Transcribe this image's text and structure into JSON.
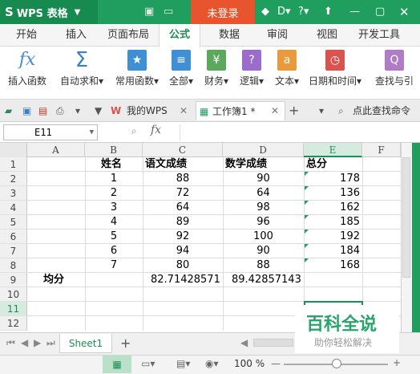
{
  "titlebar": {
    "app_name": "WPS 表格",
    "login_label": "未登录"
  },
  "ribbon_tabs": [
    "开始",
    "插入",
    "页面布局",
    "公式",
    "数据",
    "审阅",
    "视图",
    "开发工具"
  ],
  "ribbon_tab_active": "公式",
  "ribbon_buttons": {
    "insert_function": "插入函数",
    "autosum": "自动求和",
    "common_functions": "常用函数",
    "all": "全部",
    "finance": "财务",
    "logic": "逻辑",
    "text": "文本",
    "datetime": "日期和时间",
    "lookup": "查找与引"
  },
  "doc_tabs": {
    "my_wps": "我的WPS",
    "workbook": "工作簿1 *",
    "search": "点此查找命令"
  },
  "formula_bar": {
    "name_box": "E11",
    "fx": "fx"
  },
  "columns": [
    "A",
    "B",
    "C",
    "D",
    "E",
    "F"
  ],
  "rows": [
    "1",
    "2",
    "3",
    "4",
    "5",
    "6",
    "7",
    "8",
    "9",
    "10",
    "11",
    "12"
  ],
  "table": {
    "headers": {
      "name": "姓名",
      "chinese": "语文成绩",
      "math": "数学成绩",
      "total": "总分"
    },
    "data": [
      {
        "b": "1",
        "c": "88",
        "d": "90",
        "e": "178"
      },
      {
        "b": "2",
        "c": "72",
        "d": "64",
        "e": "136"
      },
      {
        "b": "3",
        "c": "64",
        "d": "98",
        "e": "162"
      },
      {
        "b": "4",
        "c": "89",
        "d": "96",
        "e": "185"
      },
      {
        "b": "5",
        "c": "92",
        "d": "100",
        "e": "192"
      },
      {
        "b": "6",
        "c": "94",
        "d": "90",
        "e": "184"
      },
      {
        "b": "7",
        "c": "80",
        "d": "88",
        "e": "168"
      }
    ],
    "avg_label": "均分",
    "avg_c": "82.71428571",
    "avg_d": "89.42857143"
  },
  "sheet_tab": "Sheet1",
  "status": {
    "zoom": "100 %"
  },
  "watermark": {
    "title": "百科全说",
    "subtitle": "助你轻松解决"
  },
  "colors": {
    "brand_green": "#1f9e5e",
    "login_orange": "#e8542d",
    "selection_green": "#1f8c53"
  }
}
